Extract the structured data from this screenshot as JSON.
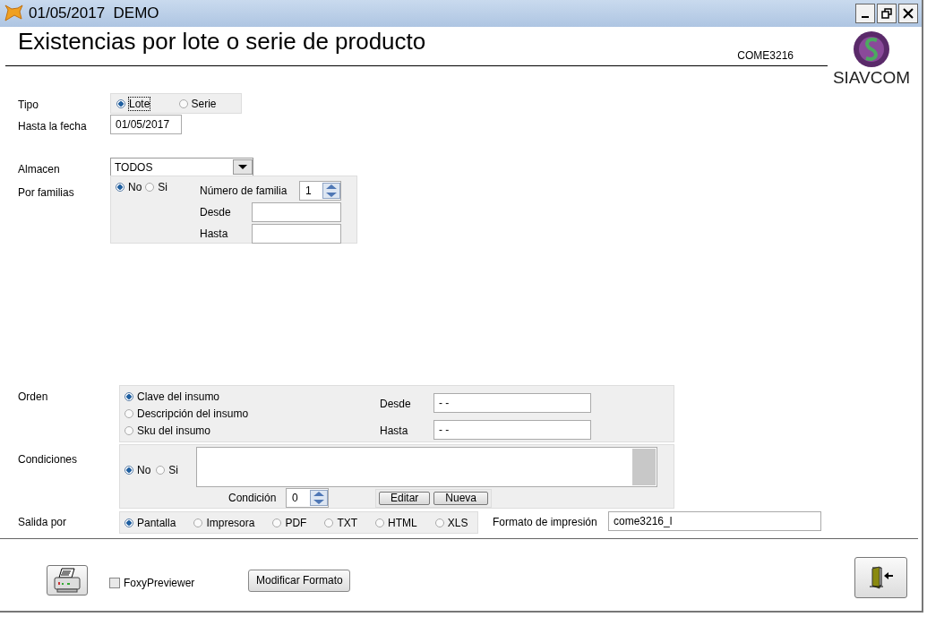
{
  "window": {
    "title": "01/05/2017  DEMO"
  },
  "header": {
    "title": "Existencias por lote o serie de producto",
    "code": "COME3216",
    "logo_text": "SIAVCOM"
  },
  "tipo": {
    "label": "Tipo",
    "options": [
      {
        "label": "Lote",
        "selected": true
      },
      {
        "label": "Serie",
        "selected": false
      }
    ]
  },
  "hasta_fecha": {
    "label": "Hasta la fecha",
    "value": "01/05/2017"
  },
  "almacen": {
    "label": "Almacen",
    "value": "TODOS"
  },
  "familias": {
    "label": "Por familias",
    "options": [
      {
        "label": "No",
        "selected": true
      },
      {
        "label": "Si",
        "selected": false
      }
    ],
    "numero_label": "Número de familia",
    "numero_value": "1",
    "desde_label": "Desde",
    "hasta_label": "Hasta"
  },
  "orden": {
    "label": "Orden",
    "options": [
      {
        "label": "Clave del insumo",
        "selected": true
      },
      {
        "label": "Descripción del insumo",
        "selected": false
      },
      {
        "label": "Sku del insumo",
        "selected": false
      }
    ],
    "desde_label": "Desde",
    "desde_value": "- -",
    "hasta_label": "Hasta",
    "hasta_value": "- -"
  },
  "condiciones": {
    "label": "Condiciones",
    "options": [
      {
        "label": "No",
        "selected": true
      },
      {
        "label": "Si",
        "selected": false
      }
    ],
    "condicion_label": "Condición",
    "condicion_value": "0",
    "buttons": [
      "Editar",
      "Nueva"
    ]
  },
  "salida": {
    "label": "Salida por",
    "options": [
      {
        "label": "Pantalla",
        "selected": true
      },
      {
        "label": "Impresora",
        "selected": false
      },
      {
        "label": "PDF",
        "selected": false
      },
      {
        "label": "TXT",
        "selected": false
      },
      {
        "label": "HTML",
        "selected": false
      },
      {
        "label": "XLS",
        "selected": false
      }
    ],
    "formato_label": "Formato de impresión",
    "formato_value": "come3216_l"
  },
  "footer": {
    "foxy": {
      "label": "FoxyPreviewer",
      "checked": false
    },
    "modificar": "Modificar Formato"
  }
}
